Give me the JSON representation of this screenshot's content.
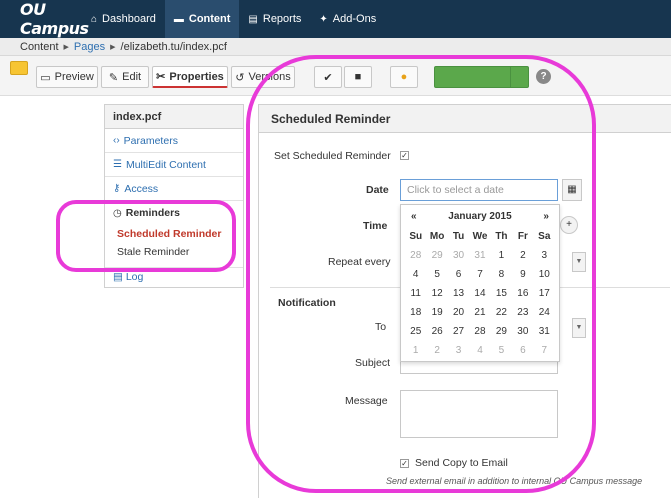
{
  "topbar": {
    "logo": "OU Campus",
    "items": [
      {
        "label": "Dashboard",
        "icon": "home-icon"
      },
      {
        "label": "Content",
        "icon": "folder-icon"
      },
      {
        "label": "Reports",
        "icon": "report-icon"
      },
      {
        "label": "Add-Ons",
        "icon": "plug-icon"
      }
    ]
  },
  "breadcrumb": {
    "root": "Content",
    "pages": "Pages",
    "path": "/elizabeth.tu/index.pcf"
  },
  "toolbar": {
    "preview": "Preview",
    "edit": "Edit",
    "properties": "Properties",
    "versions": "Versions"
  },
  "sidebar": {
    "file": "index.pcf",
    "items": [
      "Parameters",
      "MultiEdit Content",
      "Access",
      "Reminders"
    ],
    "sub_items": [
      "Scheduled Reminder",
      "Stale Reminder"
    ],
    "log": "Log"
  },
  "form": {
    "title": "Scheduled Reminder",
    "set_label": "Set Scheduled Reminder",
    "date_label": "Date",
    "date_placeholder": "Click to select a date",
    "time_label": "Time",
    "repeat_label": "Repeat every",
    "notification_heading": "Notification",
    "to_label": "To",
    "subject_label": "Subject",
    "message_label": "Message",
    "send_copy_label": "Send Copy to Email",
    "send_note": "Send external email in addition to internal OU Campus message"
  },
  "calendar": {
    "prev": "«",
    "next": "»",
    "month": "January 2015",
    "dow": [
      "Su",
      "Mo",
      "Tu",
      "We",
      "Th",
      "Fr",
      "Sa"
    ],
    "weeks": [
      [
        "28",
        "29",
        "30",
        "31",
        "1",
        "2",
        "3"
      ],
      [
        "4",
        "5",
        "6",
        "7",
        "8",
        "9",
        "10"
      ],
      [
        "11",
        "12",
        "13",
        "14",
        "15",
        "16",
        "17"
      ],
      [
        "18",
        "19",
        "20",
        "21",
        "22",
        "23",
        "24"
      ],
      [
        "25",
        "26",
        "27",
        "28",
        "29",
        "30",
        "31"
      ],
      [
        "1",
        "2",
        "3",
        "4",
        "5",
        "6",
        "7"
      ]
    ]
  },
  "colors": {
    "highlight": "#e83ad8",
    "topbar": "#17354f",
    "publish": "#5ba84b",
    "selected_sub": "#c0392b"
  }
}
